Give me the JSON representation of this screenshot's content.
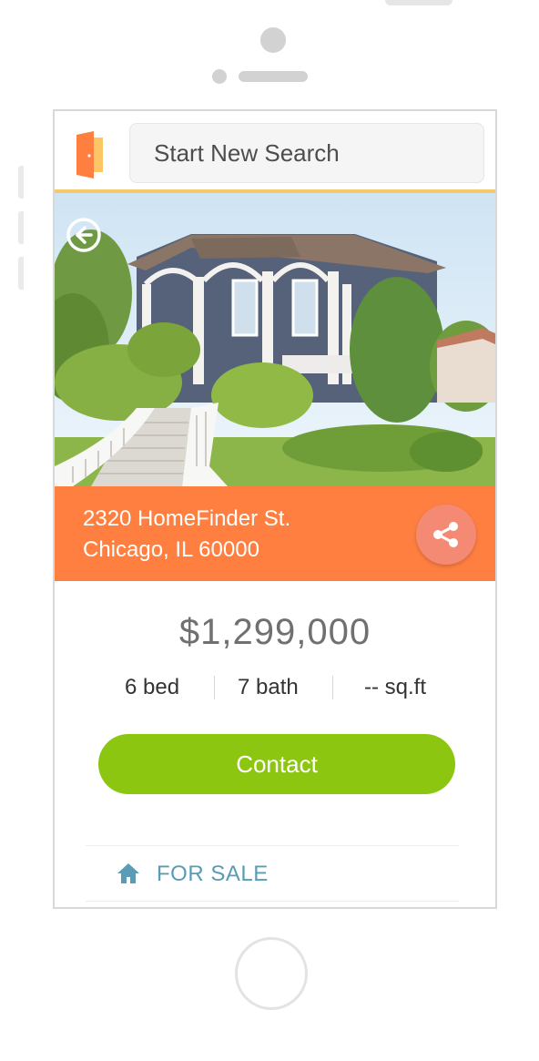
{
  "header": {
    "search_placeholder": "Start New Search"
  },
  "listing": {
    "address_line1": "2320 HomeFinder St.",
    "address_line2": "Chicago, IL 60000",
    "price": "$1,299,000",
    "beds": "6 bed",
    "baths": "7 bath",
    "sqft": "-- sq.ft",
    "contact_label": "Contact",
    "status": "FOR SALE"
  },
  "icons": {
    "logo": "door-logo-icon",
    "back": "back-arrow-icon",
    "share": "share-icon",
    "status": "home-icon"
  },
  "colors": {
    "accent_orange": "#ff7f41",
    "header_underline": "#f5c96b",
    "contact_green": "#8cc611",
    "status_blue": "#5a9bb5",
    "share_circle": "#f48a73"
  }
}
